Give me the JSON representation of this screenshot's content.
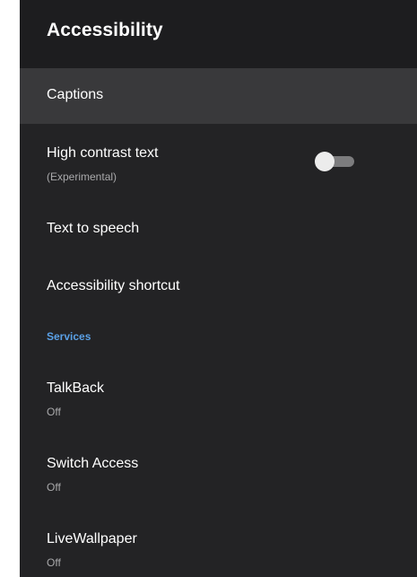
{
  "header": {
    "title": "Accessibility"
  },
  "items": {
    "captions": {
      "title": "Captions"
    },
    "high_contrast": {
      "title": "High contrast text",
      "subtitle": "(Experimental)",
      "enabled": false
    },
    "tts": {
      "title": "Text to speech"
    },
    "shortcut": {
      "title": "Accessibility shortcut"
    }
  },
  "services": {
    "header": "Services",
    "talkback": {
      "title": "TalkBack",
      "status": "Off"
    },
    "switch_access": {
      "title": "Switch Access",
      "status": "Off"
    },
    "livewallpaper": {
      "title": "LiveWallpaper",
      "status": "Off"
    }
  },
  "colors": {
    "background": "#232325",
    "header_background": "#1d1d1f",
    "focus_background": "#39393b",
    "section_accent": "#5aa0e6"
  }
}
